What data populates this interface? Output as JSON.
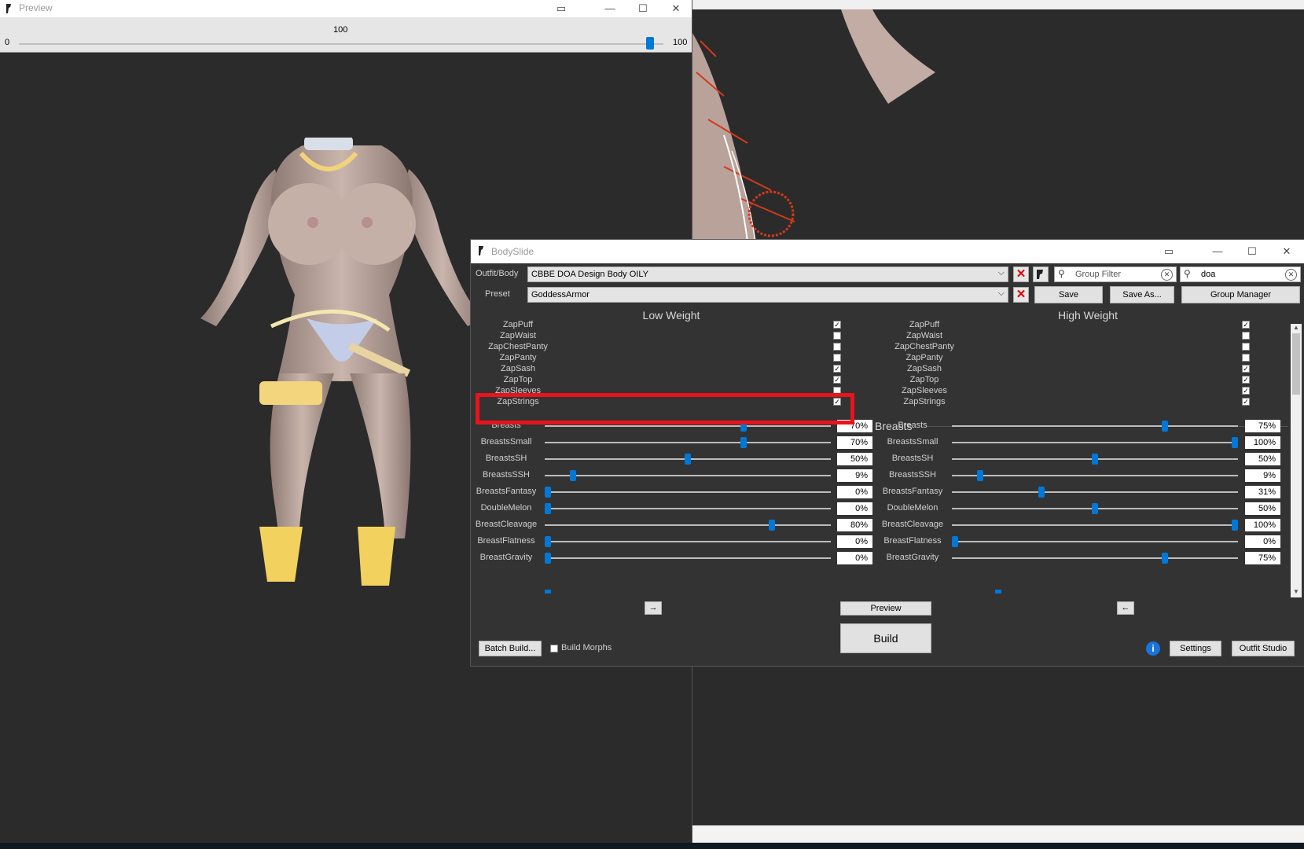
{
  "preview": {
    "title": "Preview",
    "slider": {
      "min_label": "0",
      "max_label": "100",
      "value_label": "100",
      "value": 100
    }
  },
  "bodyslide": {
    "title": "BodySlide",
    "outfit_label": "Outfit/Body",
    "outfit_value": "CBBE DOA Design Body OILY",
    "preset_label": "Preset",
    "preset_value": "GoddessArmor",
    "group_filter_placeholder": "Group Filter",
    "search_value": "doa",
    "save_label": "Save",
    "save_as_label": "Save As...",
    "group_manager_label": "Group Manager",
    "low_weight_label": "Low Weight",
    "high_weight_label": "High Weight",
    "low_zaps": [
      {
        "name": "ZapPuff",
        "checked": "✓"
      },
      {
        "name": "ZapWaist",
        "checked": ""
      },
      {
        "name": "ZapChestPanty",
        "checked": ""
      },
      {
        "name": "ZapPanty",
        "checked": ""
      },
      {
        "name": "ZapSash",
        "checked": "✓"
      },
      {
        "name": "ZapTop",
        "checked": "✓"
      },
      {
        "name": "ZapSleeves",
        "checked": ""
      },
      {
        "name": "ZapStrings",
        "checked": "✓"
      }
    ],
    "high_zaps": [
      {
        "name": "ZapPuff",
        "checked": "✓"
      },
      {
        "name": "ZapWaist",
        "checked": ""
      },
      {
        "name": "ZapChestPanty",
        "checked": ""
      },
      {
        "name": "ZapPanty",
        "checked": ""
      },
      {
        "name": "ZapSash",
        "checked": "✓"
      },
      {
        "name": "ZapTop",
        "checked": "✓"
      },
      {
        "name": "ZapSleeves",
        "checked": "✓"
      },
      {
        "name": "ZapStrings",
        "checked": "✓"
      }
    ],
    "group_label": "Breasts",
    "group_checked": "✓",
    "low_sliders": [
      {
        "name": "Breasts",
        "pct": "70%",
        "value": 70
      },
      {
        "name": "BreastsSmall",
        "pct": "70%",
        "value": 70
      },
      {
        "name": "BreastsSH",
        "pct": "50%",
        "value": 50
      },
      {
        "name": "BreastsSSH",
        "pct": "9%",
        "value": 9
      },
      {
        "name": "BreastsFantasy",
        "pct": "0%",
        "value": 0
      },
      {
        "name": "DoubleMelon",
        "pct": "0%",
        "value": 0
      },
      {
        "name": "BreastCleavage",
        "pct": "80%",
        "value": 80
      },
      {
        "name": "BreastFlatness",
        "pct": "0%",
        "value": 0
      },
      {
        "name": "BreastGravity",
        "pct": "0%",
        "value": 0
      }
    ],
    "high_sliders": [
      {
        "name": "Breasts",
        "pct": "75%",
        "value": 75
      },
      {
        "name": "BreastsSmall",
        "pct": "100%",
        "value": 100
      },
      {
        "name": "BreastsSH",
        "pct": "50%",
        "value": 50
      },
      {
        "name": "BreastsSSH",
        "pct": "9%",
        "value": 9
      },
      {
        "name": "BreastsFantasy",
        "pct": "31%",
        "value": 31
      },
      {
        "name": "DoubleMelon",
        "pct": "50%",
        "value": 50
      },
      {
        "name": "BreastCleavage",
        "pct": "100%",
        "value": 100
      },
      {
        "name": "BreastFlatness",
        "pct": "0%",
        "value": 0
      },
      {
        "name": "BreastGravity",
        "pct": "75%",
        "value": 75
      }
    ],
    "copy_right_label": "→",
    "copy_left_label": "←",
    "preview_label": "Preview",
    "build_label": "Build",
    "batch_build_label": "Batch Build...",
    "build_morphs_label": "Build Morphs",
    "settings_label": "Settings",
    "outfit_studio_label": "Outfit Studio",
    "info_icon": "i"
  }
}
